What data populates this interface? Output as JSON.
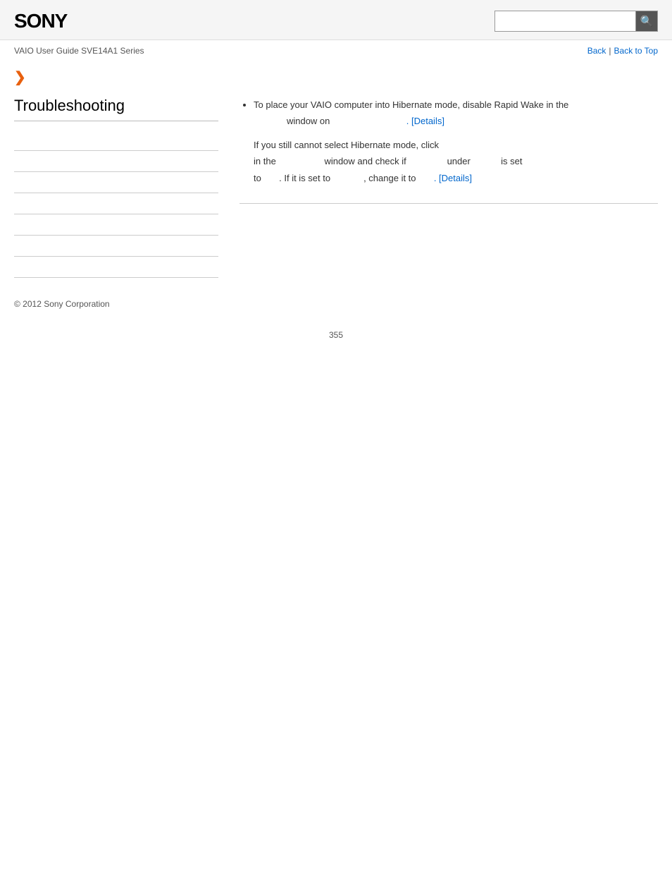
{
  "header": {
    "logo": "SONY",
    "search_placeholder": "",
    "search_icon": "🔍"
  },
  "breadcrumb": {
    "guide_title": "VAIO User Guide SVE14A1 Series",
    "back_label": "Back",
    "separator": "|",
    "back_to_top_label": "Back to Top"
  },
  "expand_arrow": "❯",
  "sidebar": {
    "title": "Troubleshooting",
    "items": [
      {
        "label": ""
      },
      {
        "label": ""
      },
      {
        "label": ""
      },
      {
        "label": ""
      },
      {
        "label": ""
      },
      {
        "label": ""
      },
      {
        "label": ""
      }
    ]
  },
  "content": {
    "bullet_text": "To place your VAIO computer into Hibernate mode, disable Rapid Wake in the",
    "window_on_prefix": "window on",
    "details_link_1": ". [Details]",
    "if_still_text": "If you still cannot select Hibernate mode, click",
    "in_the_prefix": "in the",
    "window_and_check": "window and check if",
    "under_label": "under",
    "is_set_label": "is set",
    "to_prefix": "to",
    "if_set_to": ". If it is set to",
    "change_it_to": ", change it to",
    "details_link_2": ". [Details]"
  },
  "footer": {
    "copyright": "© 2012 Sony Corporation"
  },
  "page_number": "355"
}
